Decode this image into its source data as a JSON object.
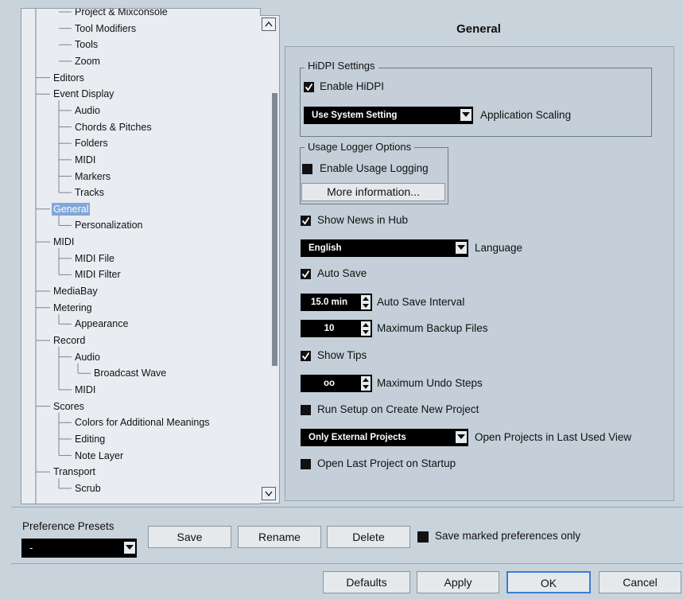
{
  "tree": {
    "items": [
      "Project & Mixconsole",
      "Tool Modifiers",
      "Tools",
      "Zoom",
      "Editors",
      "Event Display",
      "Audio",
      "Chords & Pitches",
      "Folders",
      "MIDI",
      "Markers",
      "Tracks",
      "General",
      "Personalization",
      "MIDI",
      "MIDI File",
      "MIDI Filter",
      "MediaBay",
      "Metering",
      "Appearance",
      "Record",
      "Audio",
      "Broadcast Wave",
      "MIDI",
      "Scores",
      "Colors for Additional Meanings",
      "Editing",
      "Note Layer",
      "Transport",
      "Scrub"
    ],
    "selected": "General"
  },
  "panel": {
    "title": "General",
    "hidpi": {
      "group_label": "HiDPI Settings",
      "enable_label": "Enable HiDPI",
      "enable_checked": true,
      "scaling_value": "Use System Setting",
      "scaling_label": "Application Scaling"
    },
    "usage": {
      "group_label": "Usage Logger Options",
      "enable_label": "Enable Usage Logging",
      "enable_checked": false,
      "more_button": "More information..."
    },
    "show_news_label": "Show News in Hub",
    "language_value": "English",
    "language_label": "Language",
    "auto_save_label": "Auto Save",
    "auto_save_interval_value": "15.0 min",
    "auto_save_interval_label": "Auto Save Interval",
    "max_backup_value": "10",
    "max_backup_label": "Maximum Backup Files",
    "show_tips_label": "Show Tips",
    "max_undo_value": "oo",
    "max_undo_label": "Maximum Undo Steps",
    "run_setup_label": "Run Setup on Create New Project",
    "open_projects_value": "Only External Projects",
    "open_projects_label": "Open Projects in Last Used View",
    "open_last_label": "Open Last Project on Startup"
  },
  "presets": {
    "label": "Preference Presets",
    "value": "-",
    "save": "Save",
    "rename": "Rename",
    "delete": "Delete",
    "marked_only_label": "Save marked preferences only"
  },
  "footer": {
    "defaults": "Defaults",
    "apply": "Apply",
    "ok": "OK",
    "cancel": "Cancel"
  }
}
